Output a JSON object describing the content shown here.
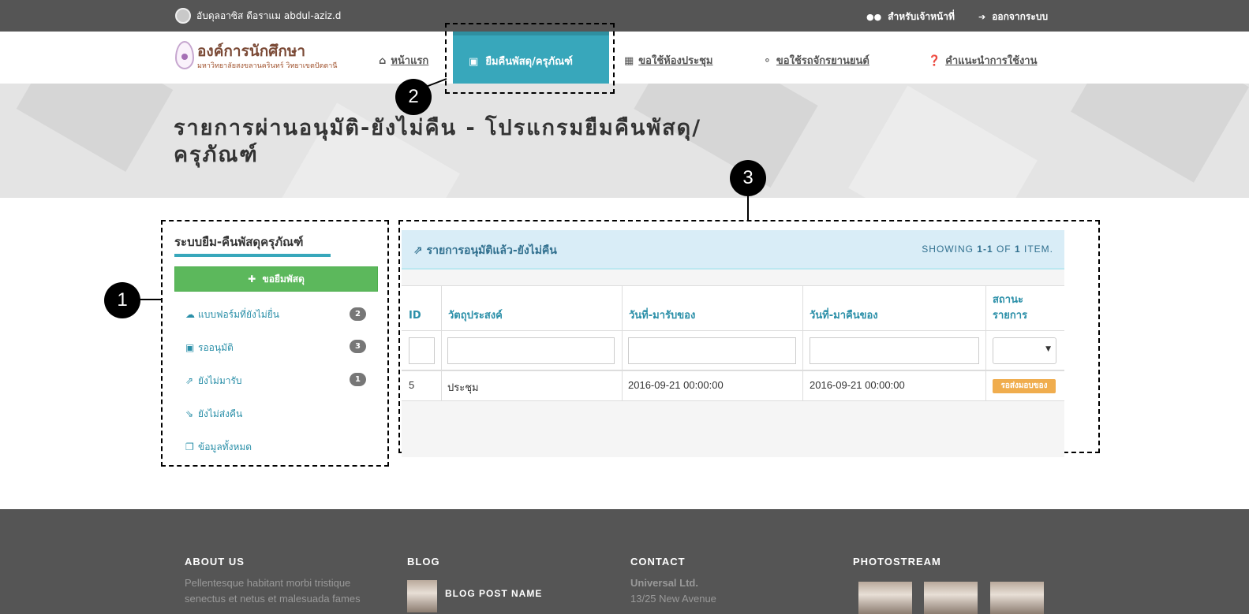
{
  "topbar": {
    "user": "อับดุลอาซิส ดือราแม abdul-aziz.d",
    "staff": "สำหรับเจ้าหน้าที่",
    "logout": "ออกจากระบบ"
  },
  "logo": {
    "title": "องค์การนักศึกษา",
    "subtitle": "มหาวิทยาลัยสงขลานครินทร์ วิทยาเขตปัตตานี"
  },
  "nav": {
    "home": "หน้าแรก",
    "borrow": "ยืมคืนพัสดุ/ครุภัณฑ์",
    "room": "ขอใช้ห้องประชุม",
    "vehicle": "ขอใช้รถจักรยานยนต์",
    "help": "คำแนะนำการใช้งาน"
  },
  "page": {
    "title": "รายการผ่านอนุมัติ-ยังไม่คืน - โปรแกรมยืมคืนพัสดุ/ครุภัณฑ์"
  },
  "annotations": [
    "1",
    "2",
    "3"
  ],
  "sidebar": {
    "title": "ระบบยืม-คืนพัสดุครุภัณฑ์",
    "borrow_button": "ขอยืมพัสดุ",
    "items": [
      {
        "label": "แบบฟอร์มที่ยังไม่ยื่น",
        "count": "2"
      },
      {
        "label": "รออนุมัติ",
        "count": "3"
      },
      {
        "label": "ยังไม่มารับ",
        "count": "1"
      },
      {
        "label": "ยังไม่ส่งคืน"
      },
      {
        "label": "ข้อมูลทั้งหมด"
      }
    ]
  },
  "panel": {
    "title": "รายการอนุมัติแล้ว-ยังไม่คืน",
    "summary_prefix": "SHOWING ",
    "summary_range": "1-1",
    "summary_mid": " OF ",
    "summary_total": "1",
    "summary_suffix": " ITEM."
  },
  "table": {
    "headers": [
      "ID",
      "วัตถุประสงค์",
      "วันที่-มารับของ",
      "วันที่-มาคืนของ",
      "สถานะ รายการ"
    ],
    "rows": [
      {
        "id": "5",
        "purpose": "ประชุม",
        "pickup": "2016-09-21 00:00:00",
        "return": "2016-09-21 00:00:00",
        "status": "รอส่งมอบของ"
      }
    ]
  },
  "footer": {
    "about_title": "ABOUT US",
    "about_text": "Pellentesque habitant morbi tristique senectus et netus et malesuada fames",
    "blog_title": "BLOG",
    "blog_post": "BLOG POST NAME",
    "contact_title": "CONTACT",
    "contact_company": "Universal Ltd.",
    "contact_address": "13/25 New Avenue",
    "photostream_title": "PHOTOSTREAM"
  },
  "colors": {
    "accent": "#38a7bb",
    "topbar": "#555555",
    "green": "#5cb85c",
    "status": "#f0ad4e",
    "panel_head": "#d9edf7"
  }
}
